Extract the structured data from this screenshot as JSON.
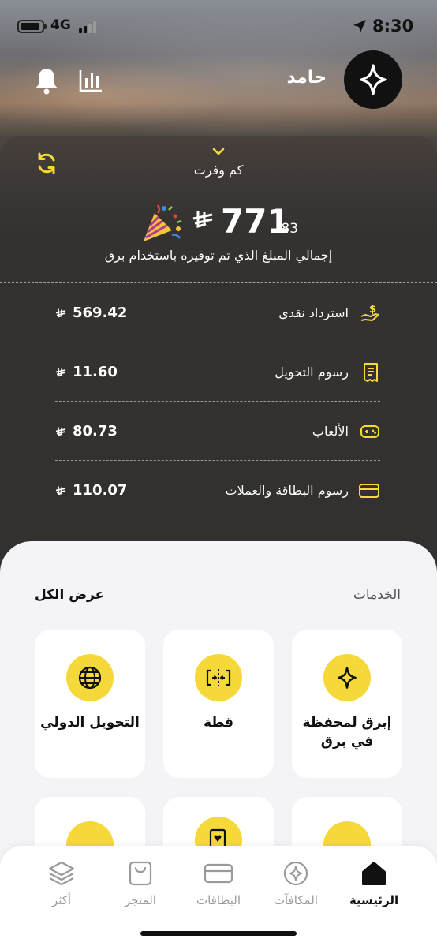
{
  "status_bar": {
    "network": "4G",
    "time": "8:30"
  },
  "header": {
    "username": "حامد",
    "logo_icon": "sparkle-icon",
    "notification_icon": "bell-icon",
    "stats_icon": "bar-chart-icon"
  },
  "savings": {
    "toggle_label": "كم وفرت",
    "refresh_icon": "refresh-icon",
    "amount_whole": "771",
    "amount_decimal": ".83",
    "currency_icon": "riyal-icon",
    "celebration_icon": "party-popper-icon",
    "subtitle": "إجمالي المبلغ الذي تم توفيره باستخدام برق",
    "items": [
      {
        "label": "استرداد نقدي",
        "value": "569.42",
        "icon": "cash-hand-icon"
      },
      {
        "label": "رسوم التحويل",
        "value": "11.60",
        "icon": "receipt-icon"
      },
      {
        "label": "الألعاب",
        "value": "80.73",
        "icon": "gamepad-icon"
      },
      {
        "label": "رسوم البطاقة والعملات",
        "value": "110.07",
        "icon": "credit-card-icon"
      }
    ]
  },
  "services": {
    "title": "الخدمات",
    "view_all": "عرض الكل",
    "tiles": [
      {
        "label": "إبرق لمحفظة في برق",
        "icon": "sparkle-icon"
      },
      {
        "label": "قطة",
        "icon": "split-bill-icon"
      },
      {
        "label": "التحويل الدولي",
        "icon": "globe-icon"
      }
    ]
  },
  "tabs": [
    {
      "label": "الرئيسية",
      "icon": "home-icon",
      "active": true
    },
    {
      "label": "المكافآت",
      "icon": "rewards-icon",
      "active": false
    },
    {
      "label": "البطاقات",
      "icon": "cards-icon",
      "active": false
    },
    {
      "label": "المتجر",
      "icon": "shopping-bag-icon",
      "active": false
    },
    {
      "label": "أكثر",
      "icon": "layers-icon",
      "active": false
    }
  ],
  "colors": {
    "accent": "#f5d93a",
    "dark": "#111111",
    "card_bg": "#333130",
    "sheet_bg": "#f4f4f6"
  }
}
